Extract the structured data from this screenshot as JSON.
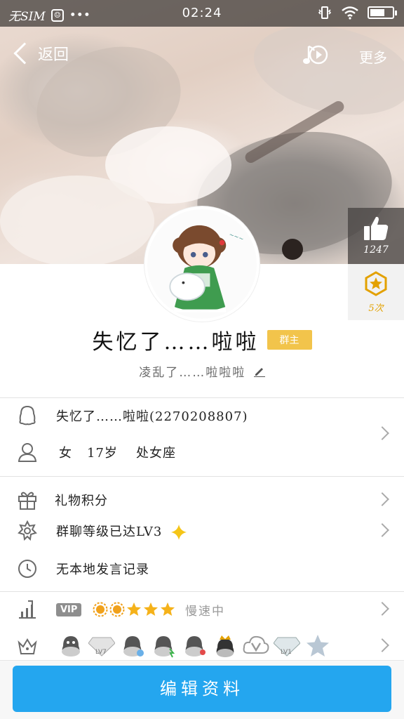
{
  "status_bar": {
    "carrier": "无SIM",
    "time": "02:24",
    "dots": "•••"
  },
  "nav": {
    "back_label": "返回",
    "more_label": "更多"
  },
  "likes": {
    "count": "1247"
  },
  "badge": {
    "times": "5次"
  },
  "profile": {
    "name": "失忆了……啦啦",
    "owner_tag": "群主",
    "signature": "凌乱了……啦啦啦"
  },
  "info": {
    "qq_line": "失忆了……啦啦(2270208807)",
    "gender": "女",
    "age": "17岁",
    "zodiac": "处女座"
  },
  "menu": {
    "gift_points": "礼物积分",
    "group_level": "群聊等级已达LV3",
    "no_local_records": "无本地发言记录"
  },
  "vip": {
    "tag": "VIP",
    "speed_text": "慢速中"
  },
  "medals": {
    "labels": [
      "LV7",
      "LV1"
    ]
  },
  "edit_button": "编辑资料",
  "colors": {
    "accent_blue": "#24a6ef",
    "owner_tag": "#f2c44b",
    "badge_gold": "#e3a100"
  }
}
